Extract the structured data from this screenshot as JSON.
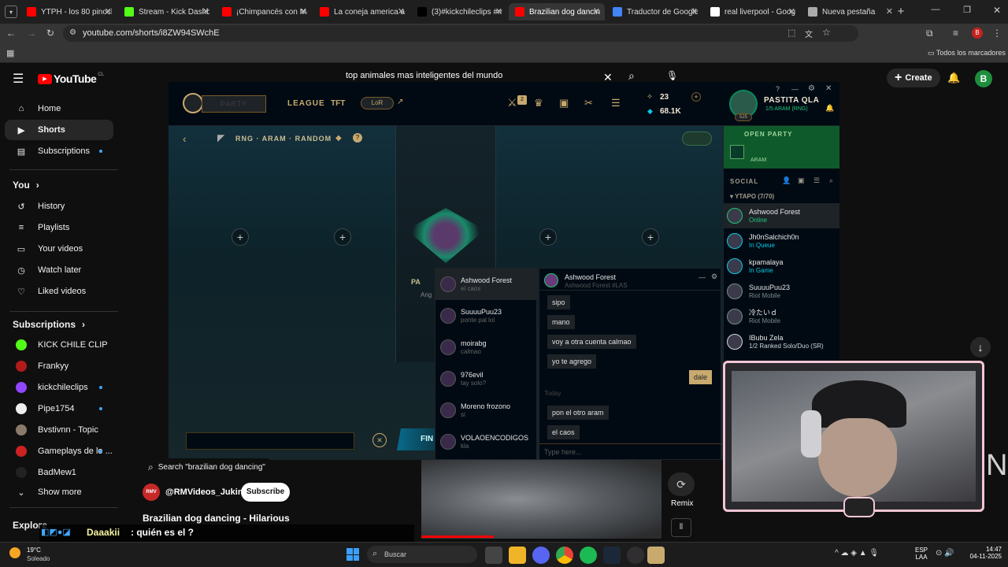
{
  "browser": {
    "tabs": [
      {
        "label": "YTPH - los 80 pinoch",
        "color": "#ff0000"
      },
      {
        "label": "Stream - Kick Dashbo",
        "color": "#53fc18"
      },
      {
        "label": "¡Chimpancés con Má",
        "color": "#ff0000"
      },
      {
        "label": "La coneja america ad",
        "color": "#ff0000"
      },
      {
        "label": "(3)#kickchileclips #m",
        "color": "#000000"
      },
      {
        "label": "Brazilian dog dancing",
        "color": "#ff0000"
      },
      {
        "label": "Traductor de Google",
        "color": "#4285f4"
      },
      {
        "label": "real liverpool - Goog",
        "color": "#ffffff"
      },
      {
        "label": "Nueva pestaña",
        "color": "#aaaaaa"
      }
    ],
    "active_tab": 5,
    "url": "youtube.com/shorts/i8ZW94SWchE",
    "bookmarks_label": "Todos los marcadores"
  },
  "youtube": {
    "logo": "YouTube",
    "region": "CL",
    "search_value": "top animales mas inteligentes del mundo",
    "create_label": "Create",
    "avatar_letter": "B",
    "nav": [
      {
        "label": "Home",
        "icon": "home-icon"
      },
      {
        "label": "Shorts",
        "icon": "shorts-icon"
      },
      {
        "label": "Subscriptions",
        "icon": "subscriptions-icon"
      }
    ],
    "you_header": "You",
    "you": [
      {
        "label": "History"
      },
      {
        "label": "Playlists"
      },
      {
        "label": "Your videos"
      },
      {
        "label": "Watch later"
      },
      {
        "label": "Liked videos"
      }
    ],
    "subs_header": "Subscriptions",
    "subs": [
      {
        "label": "KICK CHILE CLIP",
        "color": "#53fc18",
        "dot": false
      },
      {
        "label": "Frankyy",
        "color": "#b31b1b",
        "dot": false
      },
      {
        "label": "kickchileclips",
        "color": "#9146ff",
        "dot": true
      },
      {
        "label": "Pipe1754",
        "color": "#eeeeee",
        "dot": true
      },
      {
        "label": "Bvstivnn - Topic",
        "color": "#8a7a6a",
        "dot": false
      },
      {
        "label": "Gameplays de lo ...",
        "color": "#cc2222",
        "dot": true
      },
      {
        "label": "BadMew1",
        "color": "#222222",
        "dot": false
      }
    ],
    "show_more": "Show more",
    "explore": "Explore",
    "short_search": "Search \"brazilian dog dancing\"",
    "channel": "@RMVideos_Jukin",
    "channel_badge": "RMV",
    "subscribe": "Subscribe",
    "short_title": "Brazilian dog dancing - Hilarious",
    "remix": "Remix"
  },
  "lol": {
    "party_label": "PARTY",
    "nav": [
      "LEAGUE",
      "TFT",
      "LoR"
    ],
    "mode": "RNG · ARAM · RANDOM",
    "rp": "23",
    "be": "68.1K",
    "level": "525",
    "summoner": "PASTITA QLA",
    "summoner_status": "1/5 ARAM (RNG)",
    "open_party": "OPEN PARTY",
    "party_mode": "ARAM",
    "social": "SOCIAL",
    "group": "YTAPO (7/70)",
    "friends": [
      {
        "name": "Ashwood Forest",
        "status": "Online",
        "color": "#1ec77a"
      },
      {
        "name": "Jh0nSalchich0n",
        "status": "In Queue",
        "color": "#0acbe6"
      },
      {
        "name": "kpamalaya",
        "status": "In Game",
        "color": "#0acbe6"
      },
      {
        "name": "SuuuuPuu23",
        "status": "Riot Mobile",
        "color": "#7a8a8a"
      },
      {
        "name": "冷たいｄ",
        "status": "Riot Mobile",
        "color": "#7a8a8a"
      },
      {
        "name": "IBubu Zela",
        "status": "1/2 Ranked Solo/Duo (SR)",
        "color": "#cfd6d9"
      }
    ],
    "chat_list": [
      {
        "name": "Ashwood Forest",
        "sub": "el caos"
      },
      {
        "name": "SuuuuPuu23",
        "sub": "ponte pal lol"
      },
      {
        "name": "moirabg",
        "sub": "calmao"
      },
      {
        "name": "976evil",
        "sub": "tay solo?"
      },
      {
        "name": "Moreno frozono",
        "sub": "si"
      },
      {
        "name": "VOLAOENCODIGOS",
        "sub": "kla"
      }
    ],
    "chat_name": "Ashwood Forest",
    "chat_tag": "Ashwood Forest #LAS",
    "messages": [
      "sipo",
      "mano",
      "voy a otra cuenta calmao",
      "yo te agrego"
    ],
    "my_msg": "dale",
    "today": "Today",
    "messages2": [
      "pon el otro aram",
      "el caos"
    ],
    "chat_placeholder": "Type here...",
    "find": "FIN",
    "pa": "PA",
    "ang": "Ang"
  },
  "overlay": {
    "chat_user": "Daaakii",
    "chat_text": ": quién es el ?",
    "partial_letter": "N"
  },
  "taskbar": {
    "temp": "19°C",
    "weather": "Soleado",
    "search": "Buscar",
    "lang1": "ESP",
    "lang2": "LAA",
    "time": "14:47",
    "date": "04-11-2025"
  }
}
